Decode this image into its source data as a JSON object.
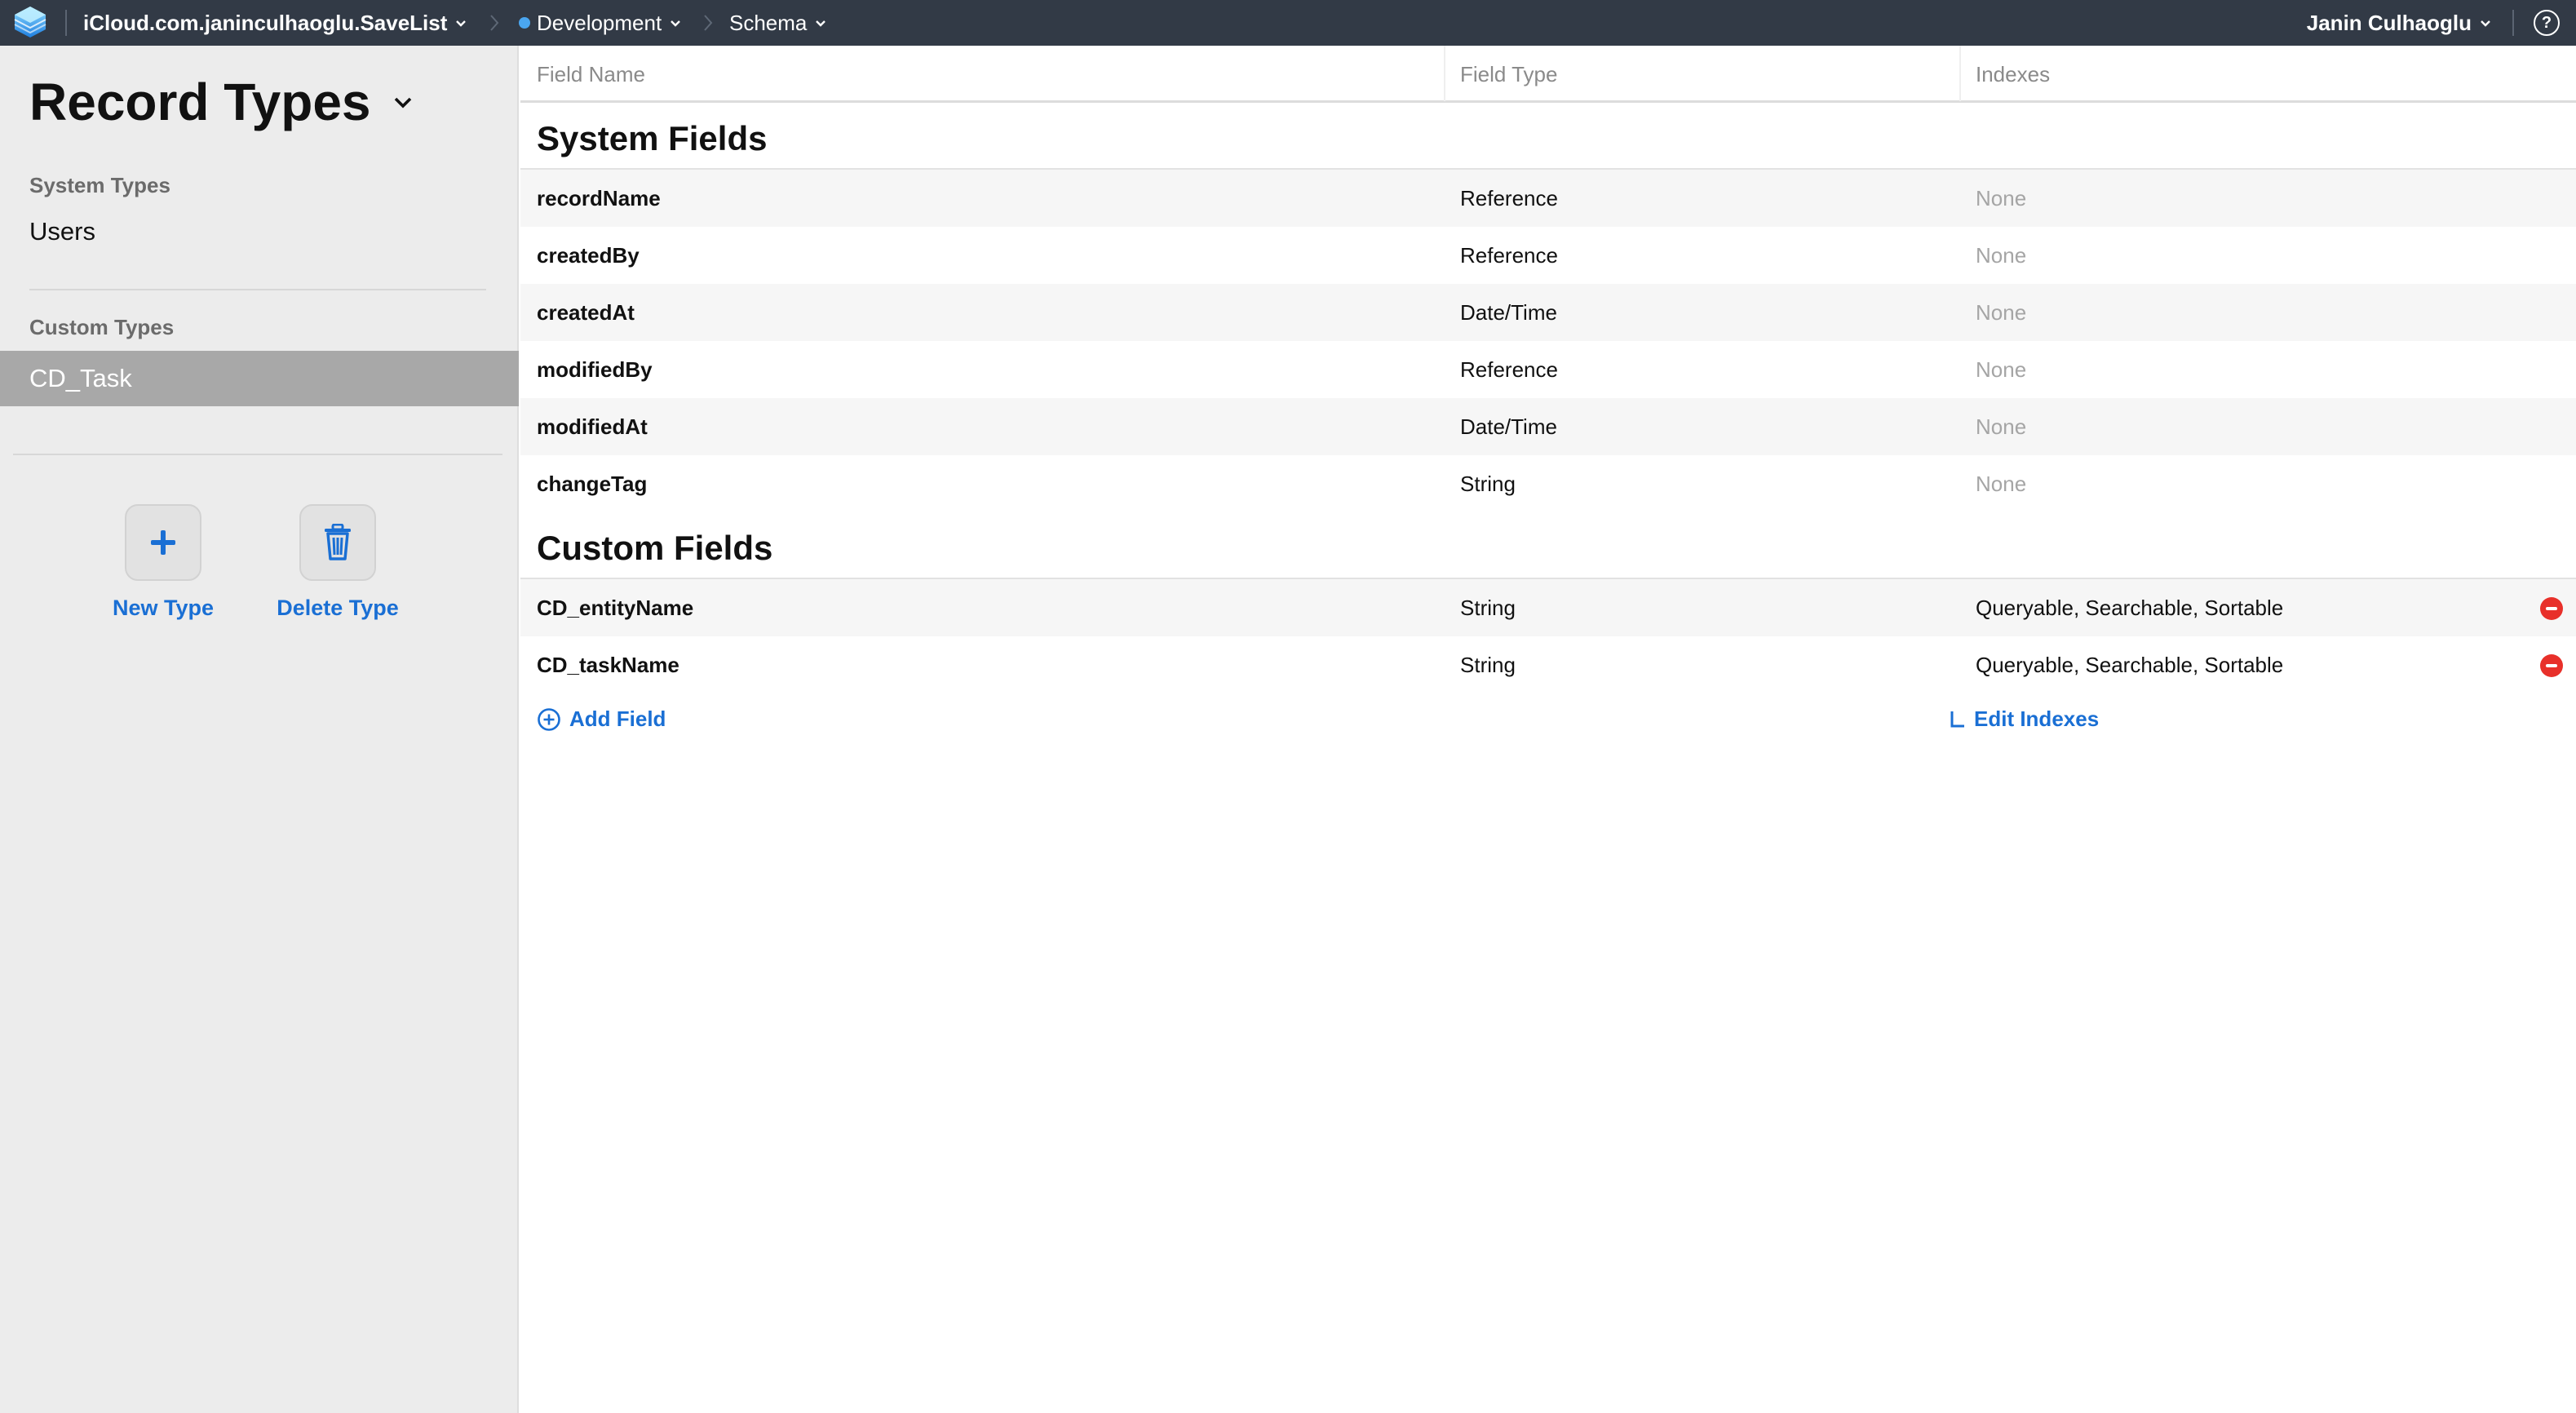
{
  "topbar": {
    "container": "iCloud.com.janinculhaoglu.SaveList",
    "environment": "Development",
    "section": "Schema",
    "user": "Janin Culhaoglu",
    "help_glyph": "?",
    "env_color": "#4aa6f0"
  },
  "sidebar": {
    "title": "Record Types",
    "system_types_label": "System Types",
    "system_types": [
      "Users"
    ],
    "custom_types_label": "Custom Types",
    "custom_types": [
      "CD_Task"
    ],
    "selected": "CD_Task",
    "new_type_label": "New Type",
    "delete_type_label": "Delete Type"
  },
  "table": {
    "headers": [
      "Field Name",
      "Field Type",
      "Indexes"
    ],
    "system_title": "System Fields",
    "system_fields": [
      {
        "name": "recordName",
        "type": "Reference",
        "indexes": "None"
      },
      {
        "name": "createdBy",
        "type": "Reference",
        "indexes": "None"
      },
      {
        "name": "createdAt",
        "type": "Date/Time",
        "indexes": "None"
      },
      {
        "name": "modifiedBy",
        "type": "Reference",
        "indexes": "None"
      },
      {
        "name": "modifiedAt",
        "type": "Date/Time",
        "indexes": "None"
      },
      {
        "name": "changeTag",
        "type": "String",
        "indexes": "None"
      }
    ],
    "custom_title": "Custom Fields",
    "custom_fields": [
      {
        "name": "CD_entityName",
        "type": "String",
        "indexes": "Queryable, Searchable, Sortable"
      },
      {
        "name": "CD_taskName",
        "type": "String",
        "indexes": "Queryable, Searchable, Sortable"
      }
    ],
    "add_field_label": "Add Field",
    "edit_indexes_label": "Edit Indexes"
  },
  "colors": {
    "topbar": "#323a46",
    "accent": "#1a6fd4",
    "remove": "#e8302a",
    "selected_row": "#a8a8a8"
  },
  "icons": [
    "cloudkit-logo-icon",
    "chevron-down-icon",
    "breadcrumb-chevron-icon",
    "help-icon",
    "plus-icon",
    "trash-icon",
    "remove-field-icon",
    "add-circle-icon",
    "edit-indexes-icon"
  ]
}
